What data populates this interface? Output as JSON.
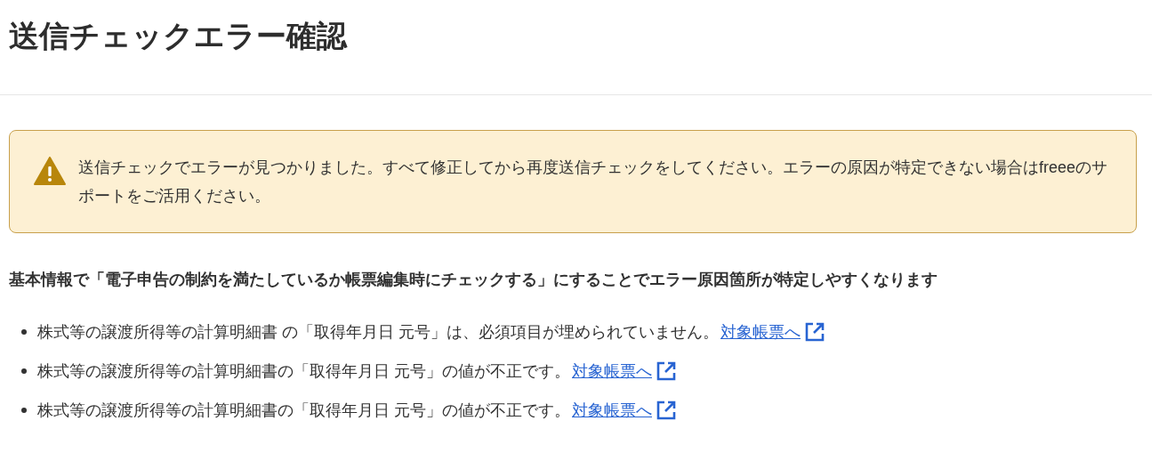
{
  "title": "送信チェックエラー確認",
  "alert": {
    "message": "送信チェックでエラーが見つかりました。すべて修正してから再度送信チェックをしてください。エラーの原因が特定できない場合はfreeeのサポートをご活用ください。"
  },
  "hint": "基本情報で「電子申告の制約を満たしているか帳票編集時にチェックする」にすることでエラー原因箇所が特定しやすくなります",
  "errors": [
    {
      "message": "株式等の譲渡所得等の計算明細書 の「取得年月日 元号」は、必須項目が埋められていません。",
      "link": "対象帳票へ"
    },
    {
      "message": "株式等の譲渡所得等の計算明細書の「取得年月日 元号」の値が不正です。",
      "link": "対象帳票へ"
    },
    {
      "message": "株式等の譲渡所得等の計算明細書の「取得年月日 元号」の値が不正です。",
      "link": "対象帳票へ"
    }
  ]
}
